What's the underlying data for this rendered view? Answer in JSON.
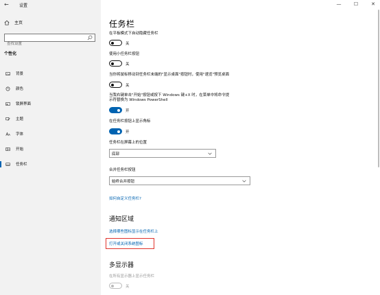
{
  "window": {
    "title": "设置",
    "back_glyph": "←",
    "controls": {
      "minimize": "—",
      "maximize": "☐",
      "close": "✕"
    }
  },
  "sidebar": {
    "home_label": "主页",
    "search_placeholder": "查找设置",
    "section": "个性化",
    "items": [
      {
        "label": "背景",
        "icon": "image-icon"
      },
      {
        "label": "颜色",
        "icon": "palette-icon"
      },
      {
        "label": "锁屏界面",
        "icon": "lock-screen-icon"
      },
      {
        "label": "主题",
        "icon": "theme-brush-icon"
      },
      {
        "label": "字体",
        "icon": "font-icon"
      },
      {
        "label": "开始",
        "icon": "start-grid-icon"
      },
      {
        "label": "任务栏",
        "icon": "taskbar-icon",
        "active": true
      }
    ]
  },
  "main": {
    "title": "任务栏",
    "settings": [
      {
        "label": "在平板模式下自动隐藏任务栏",
        "state": "关"
      },
      {
        "label": "使用小任务栏按钮",
        "state": "关"
      },
      {
        "label": "当你将鼠标移动到任务栏末端的\"显示桌面\"按钮时，使用\"速览\"预览桌面",
        "state": "关"
      },
      {
        "label_line1": "当我右键单击\"开始\"按钮或按下 Windows 键+X 时，在菜单中将命令提",
        "label_line2": "示符替换为 Windows PowerShell",
        "state": "开"
      },
      {
        "label": "在任务栏按钮上显示角标",
        "state": "开"
      }
    ],
    "position": {
      "label": "任务栏在屏幕上的位置",
      "value": "底部"
    },
    "combine": {
      "label": "合并任务栏按钮",
      "value": "始终合并按钮"
    },
    "customize_link": "如何自定义任务栏?",
    "notification": {
      "title": "通知区域",
      "link1": "选择哪些图标显示在任务栏上",
      "link2": "打开或关闭系统图标"
    },
    "multi_display": {
      "title": "多显示器",
      "label": "在所有显示器上显示任务栏",
      "state": "关"
    }
  },
  "colors": {
    "accent": "#0063b1",
    "highlight_border": "#e0322b",
    "sidebar_bg": "#f2f2f2"
  }
}
